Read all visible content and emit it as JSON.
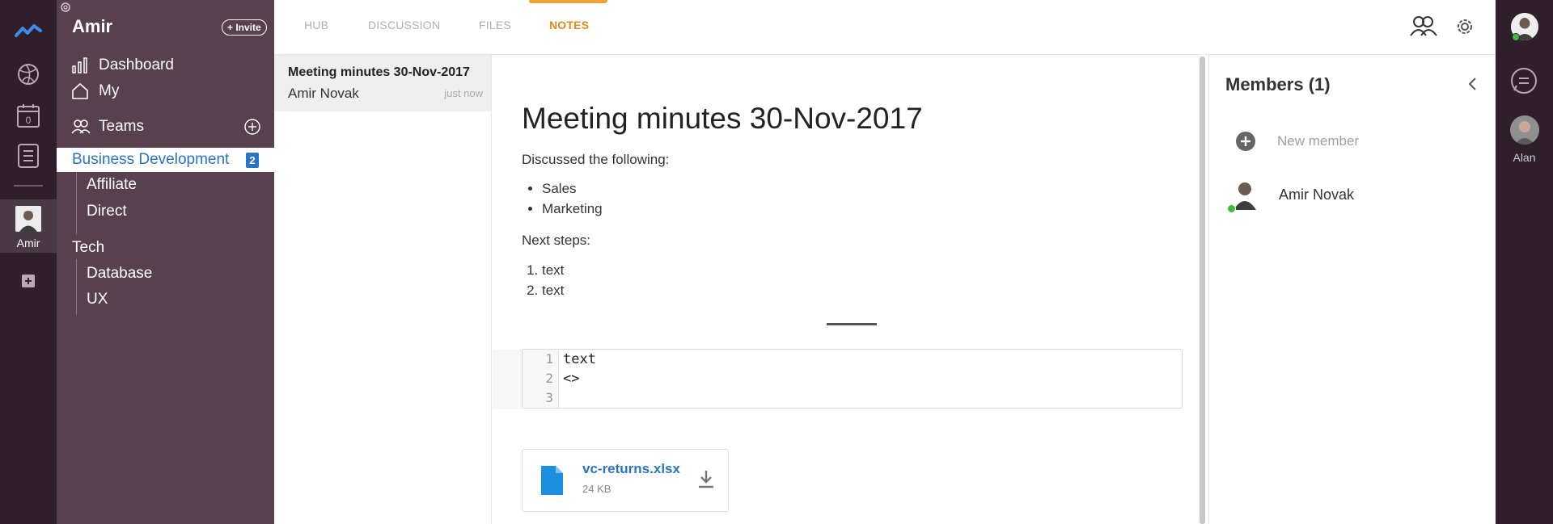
{
  "rail": {
    "user_label": "Amir",
    "calendar_count": "0"
  },
  "sidebar": {
    "team_name": "Amir",
    "invite_label": "+ Invite",
    "nav": [
      {
        "label": "Dashboard"
      },
      {
        "label": "My"
      },
      {
        "label": "Teams"
      }
    ],
    "groups": [
      {
        "label": "Business Development",
        "badge": "2",
        "children": [
          {
            "label": "Affiliate"
          },
          {
            "label": "Direct"
          }
        ]
      },
      {
        "label": "Tech",
        "children": [
          {
            "label": "Database"
          },
          {
            "label": "UX"
          }
        ]
      }
    ]
  },
  "tabs": [
    {
      "label": "HUB"
    },
    {
      "label": "DISCUSSION"
    },
    {
      "label": "FILES"
    },
    {
      "label": "NOTES",
      "active": true
    }
  ],
  "notes_list": [
    {
      "title": "Meeting minutes 30-Nov-2017",
      "author": "Amir Novak",
      "time": "just now"
    }
  ],
  "editor": {
    "title": "Meeting minutes 30-Nov-2017",
    "intro": "Discussed the following:",
    "bullets": [
      "Sales",
      "Marketing"
    ],
    "next_steps_label": "Next steps:",
    "steps": [
      "text",
      "text"
    ],
    "code_lines": [
      {
        "num": "1",
        "text": "text"
      },
      {
        "num": "2",
        "text": "<>"
      },
      {
        "num": "3",
        "text": ""
      }
    ],
    "attachment": {
      "name": "vc-returns.xlsx",
      "size": "24 KB"
    }
  },
  "members": {
    "title": "Members (1)",
    "new_member_label": "New member",
    "list": [
      {
        "name": "Amir Novak",
        "online": true
      }
    ]
  },
  "right_rail": {
    "contact_name": "Alan"
  },
  "colors": {
    "rail_bg": "#2e1f2b",
    "sidebar_bg": "#59404f",
    "accent_blue": "#2b74c4",
    "active_tab": "#de8d1b",
    "online": "#44b847"
  }
}
